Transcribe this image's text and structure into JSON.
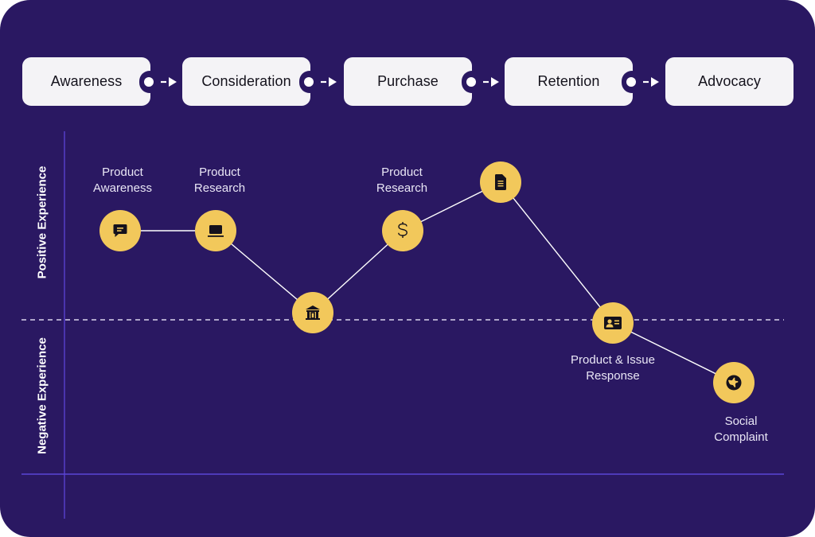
{
  "stages": [
    {
      "label": "Awareness"
    },
    {
      "label": "Consideration"
    },
    {
      "label": "Purchase"
    },
    {
      "label": "Retention"
    },
    {
      "label": "Advocacy"
    }
  ],
  "axis": {
    "positive_label": "Positive Experience",
    "negative_label": "Negative Experience"
  },
  "touchpoints": [
    {
      "label_line1": "Product",
      "label_line2": "Awareness",
      "icon": "chat-bubble-icon",
      "sentiment": "positive",
      "level": 1.0
    },
    {
      "label_line1": "Product",
      "label_line2": "Research",
      "icon": "laptop-icon",
      "sentiment": "positive",
      "level": 1.0
    },
    {
      "label_line1": "",
      "label_line2": "",
      "icon": "bank-icon",
      "sentiment": "neutral",
      "level": 0.05
    },
    {
      "label_line1": "Product",
      "label_line2": "Research",
      "icon": "dollar-icon",
      "sentiment": "positive",
      "level": 1.0
    },
    {
      "label_line1": "",
      "label_line2": "",
      "icon": "document-icon",
      "sentiment": "positive",
      "level": 1.5
    },
    {
      "label_line1": "Product & Issue",
      "label_line2": "Response",
      "icon": "id-card-icon",
      "sentiment": "neutral",
      "level": -0.03
    },
    {
      "label_line1": "Social",
      "label_line2": "Complaint",
      "icon": "globe-icon",
      "sentiment": "negative",
      "level": -0.7
    }
  ],
  "colors": {
    "background": "#2a1862",
    "stage_card": "#f4f3f6",
    "node_fill": "#f2c85b",
    "axis_line": "#5b45d6",
    "connector": "#ffffff"
  }
}
